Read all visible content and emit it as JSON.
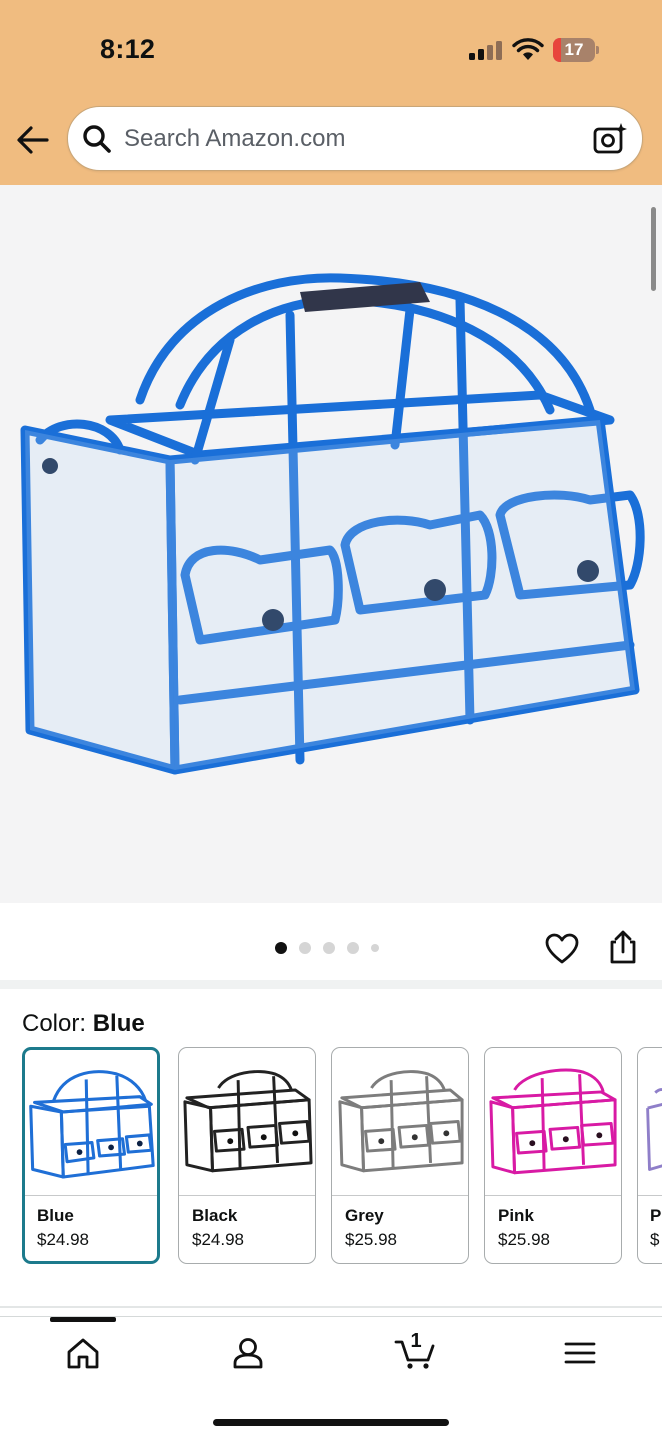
{
  "status_bar": {
    "time": "8:12",
    "battery_percent": "17"
  },
  "header": {
    "back_icon": "left-arrow-icon",
    "search": {
      "placeholder": "Search Amazon.com",
      "value": ""
    },
    "camera_icon": "camera-sparkle-icon"
  },
  "gallery": {
    "image_description_icon": "product-image",
    "dots_total": 5,
    "active_dot": 0,
    "heart_icon": "heart-icon",
    "share_icon": "share-icon"
  },
  "color_selector": {
    "label": "Color:",
    "selected": "Blue",
    "options": [
      {
        "name": "Blue",
        "price": "$24.98",
        "color": "#1f6fd6"
      },
      {
        "name": "Black",
        "price": "$24.98",
        "color": "#222222"
      },
      {
        "name": "Grey",
        "price": "$25.98",
        "color": "#7d7d7d"
      },
      {
        "name": "Pink",
        "price": "$25.98",
        "color": "#d81aa4"
      },
      {
        "name": "P",
        "price": "$",
        "color": "#8f7fc9"
      }
    ]
  },
  "bottom_nav": {
    "items": [
      "home-icon",
      "account-icon",
      "cart-icon",
      "menu-icon"
    ],
    "cart_count": "1"
  },
  "colors": {
    "header_bg": "#f0bc80",
    "selected_border": "#1c7a8c"
  }
}
